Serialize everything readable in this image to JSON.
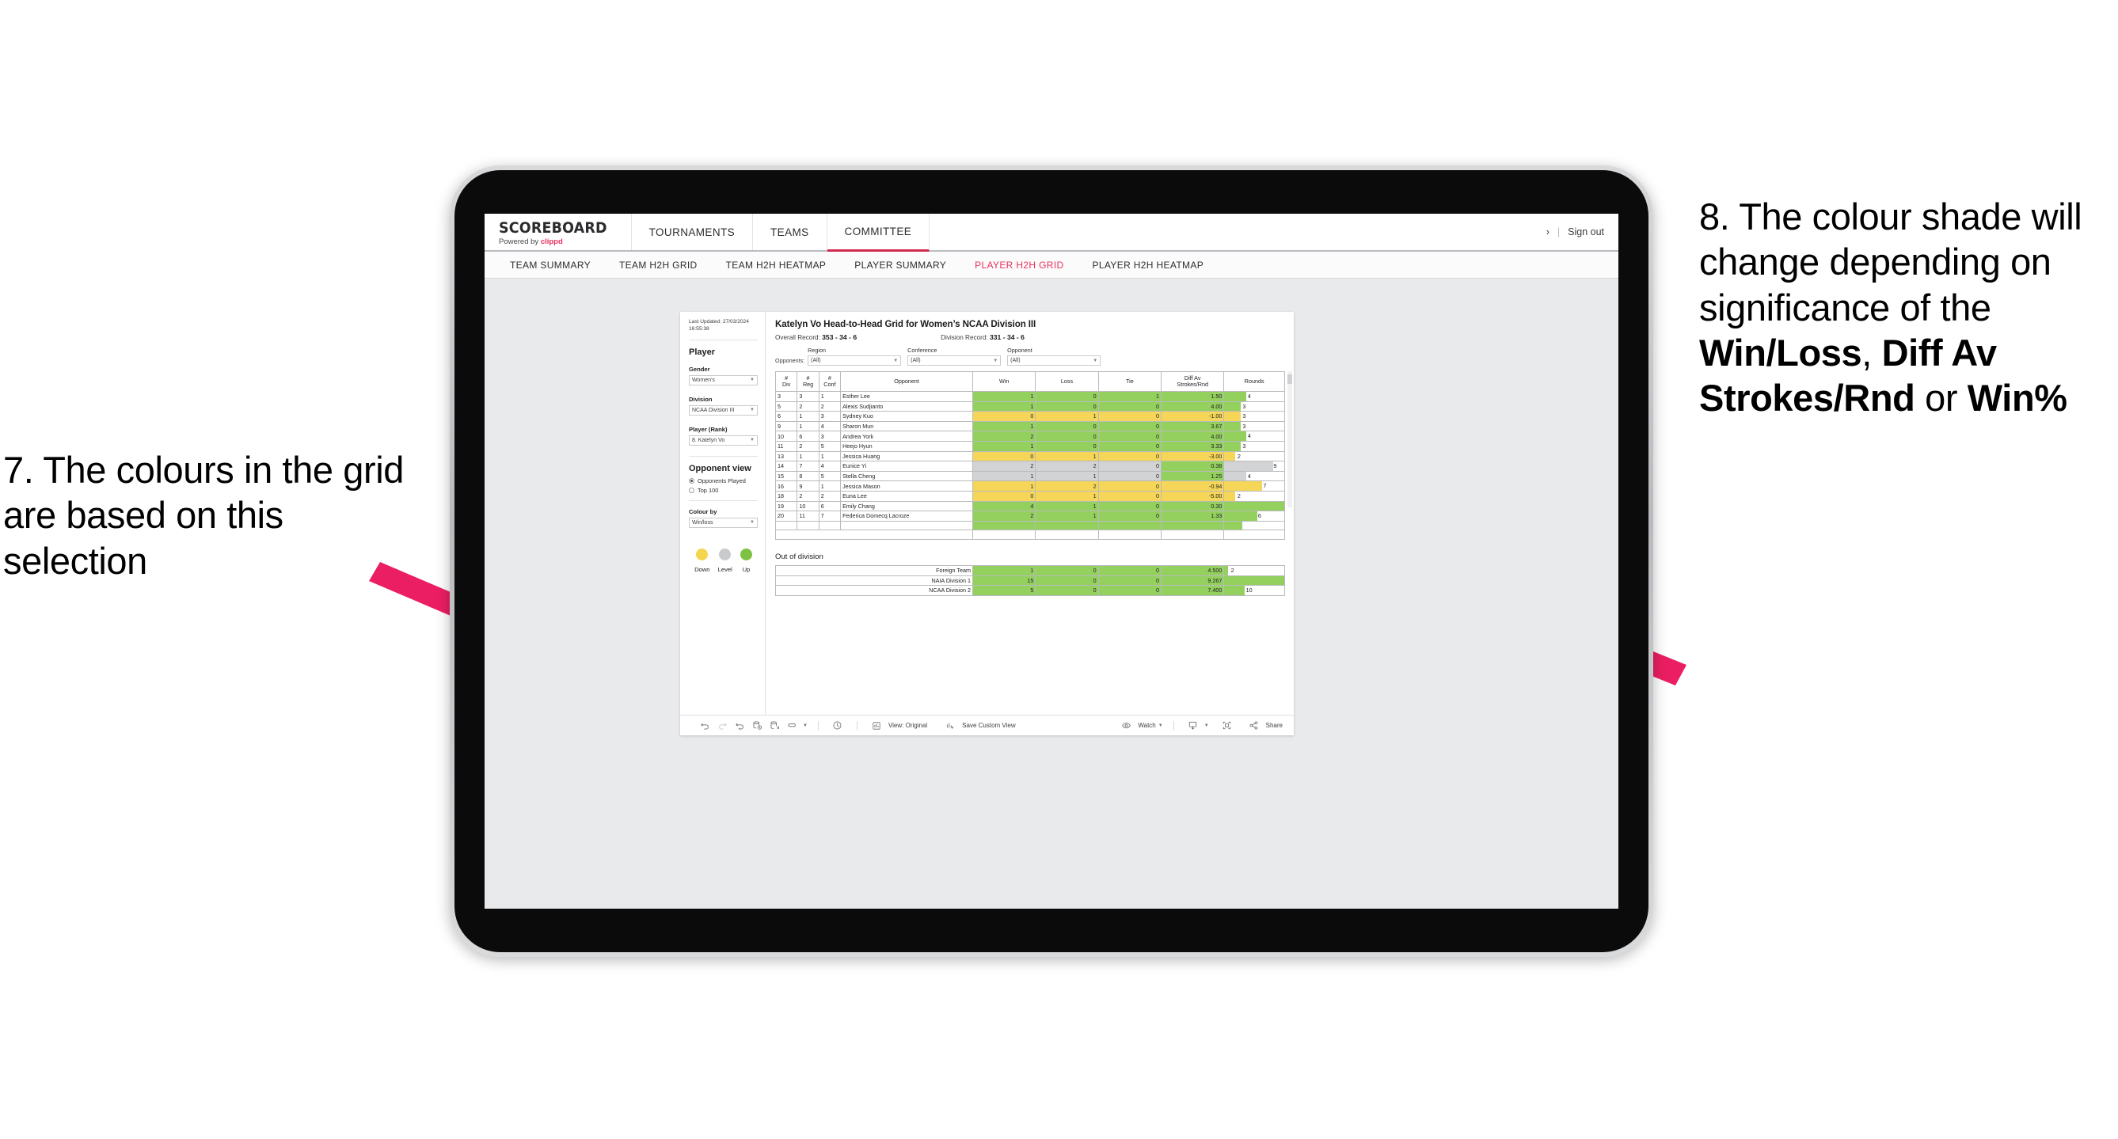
{
  "annotations": {
    "left": {
      "number": "7.",
      "text": "The colours in the grid are based on this selection"
    },
    "right": {
      "number": "8.",
      "part1": "The colour shade will change depending on significance of the ",
      "bold1": "Win/Loss",
      "mid1": ", ",
      "bold2": "Diff Av Strokes/Rnd",
      "mid2": " or ",
      "bold3": "Win%"
    },
    "arrow_color": "#ec1e63"
  },
  "app": {
    "brand": {
      "name": "SCOREBOARD",
      "powered_prefix": "Powered by ",
      "powered_brand": "clippd"
    },
    "main_nav": [
      {
        "label": "TOURNAMENTS",
        "active": false
      },
      {
        "label": "TEAMS",
        "active": false
      },
      {
        "label": "COMMITTEE",
        "active": true
      }
    ],
    "right_controls": {
      "chevron": "›",
      "divider": "|",
      "sign_out": "Sign out"
    },
    "sub_nav": [
      {
        "label": "TEAM SUMMARY",
        "active": false
      },
      {
        "label": "TEAM H2H GRID",
        "active": false
      },
      {
        "label": "TEAM H2H HEATMAP",
        "active": false
      },
      {
        "label": "PLAYER SUMMARY",
        "active": false
      },
      {
        "label": "PLAYER H2H GRID",
        "active": true
      },
      {
        "label": "PLAYER H2H HEATMAP",
        "active": false
      }
    ]
  },
  "sidebar": {
    "last_updated": "Last Updated: 27/03/2024 16:55:38",
    "player_section_title": "Player",
    "filters": [
      {
        "label": "Gender",
        "value": "Women’s"
      },
      {
        "label": "Division",
        "value": "NCAA Division III"
      },
      {
        "label": "Player (Rank)",
        "value": "8. Katelyn Vo"
      }
    ],
    "opponent_view": {
      "title": "Opponent view",
      "options": [
        {
          "label": "Opponents Played",
          "selected": true
        },
        {
          "label": "Top 100",
          "selected": false
        }
      ]
    },
    "colour_by": {
      "label": "Colour by",
      "value": "Win/loss"
    },
    "legend": [
      {
        "label": "Down",
        "color": "#f5d44e"
      },
      {
        "label": "Level",
        "color": "#c9cacc"
      },
      {
        "label": "Up",
        "color": "#7dc242"
      }
    ]
  },
  "main": {
    "title": "Katelyn Vo Head-to-Head Grid for Women’s NCAA Division III",
    "overall_record_label": "Overall Record: ",
    "overall_record_value": "353 -  34 - 6",
    "division_record_label": "Division Record: ",
    "division_record_value": "331 -  34 - 6",
    "opponents_label": "Opponents:",
    "opponent_filters": [
      {
        "label": "Region",
        "value": "(All)"
      },
      {
        "label": "Conference",
        "value": "(All)"
      },
      {
        "label": "Opponent",
        "value": "(All)"
      }
    ]
  },
  "chart_data": {
    "type": "table",
    "title": "Katelyn Vo Head-to-Head Grid for Women’s NCAA Division III",
    "columns": [
      "# Div",
      "# Reg",
      "# Conf",
      "Opponent",
      "Win",
      "Loss",
      "Tie",
      "Diff Av Strokes/Rnd",
      "Rounds"
    ],
    "column_headers_multiline": [
      {
        "line1": "#",
        "line2": "Div"
      },
      {
        "line1": "#",
        "line2": "Reg"
      },
      {
        "line1": "#",
        "line2": "Conf"
      },
      {
        "line1": "Opponent",
        "line2": ""
      },
      {
        "line1": "Win",
        "line2": ""
      },
      {
        "line1": "Loss",
        "line2": ""
      },
      {
        "line1": "Tie",
        "line2": ""
      },
      {
        "line1": "Diff Av",
        "line2": "Strokes/Rnd"
      },
      {
        "line1": "Rounds",
        "line2": ""
      }
    ],
    "rounds_max": 11,
    "rows": [
      {
        "div": "3",
        "reg": "3",
        "conf": "1",
        "opponent": "Esther Lee",
        "win": "1",
        "loss": "0",
        "tie": "1",
        "diff": "1.50",
        "rounds": "4",
        "shade": "g",
        "diff_shade": "g"
      },
      {
        "div": "5",
        "reg": "2",
        "conf": "2",
        "opponent": "Alexis Sudjianto",
        "win": "1",
        "loss": "0",
        "tie": "0",
        "diff": "4.00",
        "rounds": "3",
        "shade": "g",
        "diff_shade": "g"
      },
      {
        "div": "6",
        "reg": "1",
        "conf": "3",
        "opponent": "Sydney Kuo",
        "win": "0",
        "loss": "1",
        "tie": "0",
        "diff": "-1.00",
        "rounds": "3",
        "shade": "y",
        "diff_shade": "y"
      },
      {
        "div": "9",
        "reg": "1",
        "conf": "4",
        "opponent": "Sharon Mun",
        "win": "1",
        "loss": "0",
        "tie": "0",
        "diff": "3.67",
        "rounds": "3",
        "shade": "g",
        "diff_shade": "g"
      },
      {
        "div": "10",
        "reg": "6",
        "conf": "3",
        "opponent": "Andrea York",
        "win": "2",
        "loss": "0",
        "tie": "0",
        "diff": "4.00",
        "rounds": "4",
        "shade": "g",
        "diff_shade": "g"
      },
      {
        "div": "11",
        "reg": "2",
        "conf": "5",
        "opponent": "Heejo Hyun",
        "win": "1",
        "loss": "0",
        "tie": "0",
        "diff": "3.33",
        "rounds": "3",
        "shade": "g",
        "diff_shade": "g"
      },
      {
        "div": "13",
        "reg": "1",
        "conf": "1",
        "opponent": "Jessica Huang",
        "win": "0",
        "loss": "1",
        "tie": "0",
        "diff": "-3.00",
        "rounds": "2",
        "shade": "y",
        "diff_shade": "y"
      },
      {
        "div": "14",
        "reg": "7",
        "conf": "4",
        "opponent": "Eunice Yi",
        "win": "2",
        "loss": "2",
        "tie": "0",
        "diff": "0.38",
        "rounds": "9",
        "shade": "gr",
        "diff_shade": "g"
      },
      {
        "div": "15",
        "reg": "8",
        "conf": "5",
        "opponent": "Stella Cheng",
        "win": "1",
        "loss": "1",
        "tie": "0",
        "diff": "1.25",
        "rounds": "4",
        "shade": "gr",
        "diff_shade": "g"
      },
      {
        "div": "16",
        "reg": "9",
        "conf": "1",
        "opponent": "Jessica Mason",
        "win": "1",
        "loss": "2",
        "tie": "0",
        "diff": "-0.94",
        "rounds": "7",
        "shade": "y",
        "diff_shade": "y"
      },
      {
        "div": "18",
        "reg": "2",
        "conf": "2",
        "opponent": "Euna Lee",
        "win": "0",
        "loss": "1",
        "tie": "0",
        "diff": "-5.00",
        "rounds": "2",
        "shade": "y",
        "diff_shade": "y"
      },
      {
        "div": "19",
        "reg": "10",
        "conf": "6",
        "opponent": "Emily Chang",
        "win": "4",
        "loss": "1",
        "tie": "0",
        "diff": "0.30",
        "rounds": "11",
        "shade": "g",
        "diff_shade": "g"
      },
      {
        "div": "20",
        "reg": "11",
        "conf": "7",
        "opponent": "Federica Domecq Lacroze",
        "win": "2",
        "loss": "1",
        "tie": "0",
        "diff": "1.33",
        "rounds": "6",
        "shade": "g",
        "diff_shade": "g"
      }
    ]
  },
  "out_of_division": {
    "title": "Out of division",
    "rounds_max": 30,
    "rows": [
      {
        "name": "Foreign Team",
        "win": "1",
        "loss": "0",
        "tie": "0",
        "diff": "4.500",
        "rounds": "2",
        "shade": "g"
      },
      {
        "name": "NAIA Division 1",
        "win": "15",
        "loss": "0",
        "tie": "0",
        "diff": "9.267",
        "rounds": "30",
        "shade": "g"
      },
      {
        "name": "NCAA Division 2",
        "win": "5",
        "loss": "0",
        "tie": "0",
        "diff": "7.400",
        "rounds": "10",
        "shade": "g"
      }
    ]
  },
  "toolbar": {
    "view_label": "View: Original",
    "save_label": "Save Custom View",
    "watch_label": "Watch",
    "share_label": "Share"
  }
}
